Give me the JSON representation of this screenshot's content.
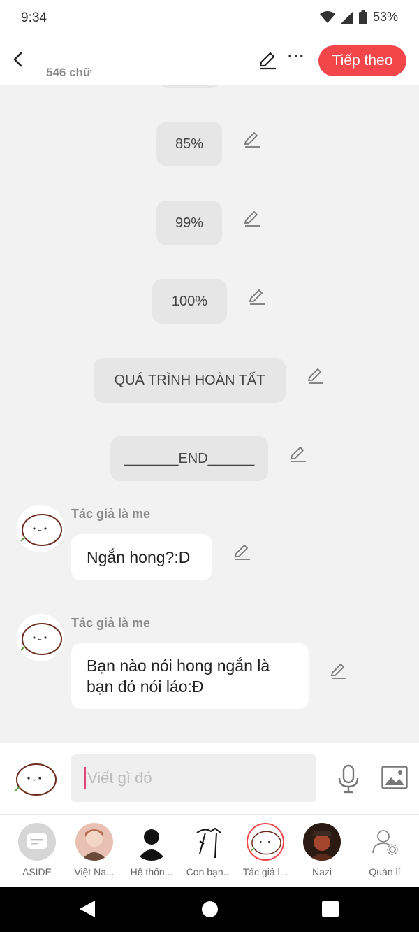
{
  "status": {
    "time": "9:34",
    "battery": "53%"
  },
  "header": {
    "word_count": "546 chữ",
    "next_label": "Tiếp theo"
  },
  "narration": [
    "85%",
    "99%",
    "100%",
    "QUÁ TRÌNH HOÀN TẤT",
    "_______END______"
  ],
  "messages": [
    {
      "author": "Tác giả là me",
      "text": "Ngắn hong?:D"
    },
    {
      "author": "Tác giả là me",
      "text": "Bạn nào nói hong ngắn là bạn đó nói láo:Đ"
    }
  ],
  "composer": {
    "placeholder": "Viết gì đó"
  },
  "characters": [
    {
      "label": "ASIDE"
    },
    {
      "label": "Việt Na..."
    },
    {
      "label": "Hệ thốn..."
    },
    {
      "label": "Con bạn..."
    },
    {
      "label": "Tác giả l..."
    },
    {
      "label": "Nazi"
    },
    {
      "label": "Quản lí"
    }
  ],
  "colors": {
    "accent": "#f2464a",
    "caret": "#e0457a"
  }
}
